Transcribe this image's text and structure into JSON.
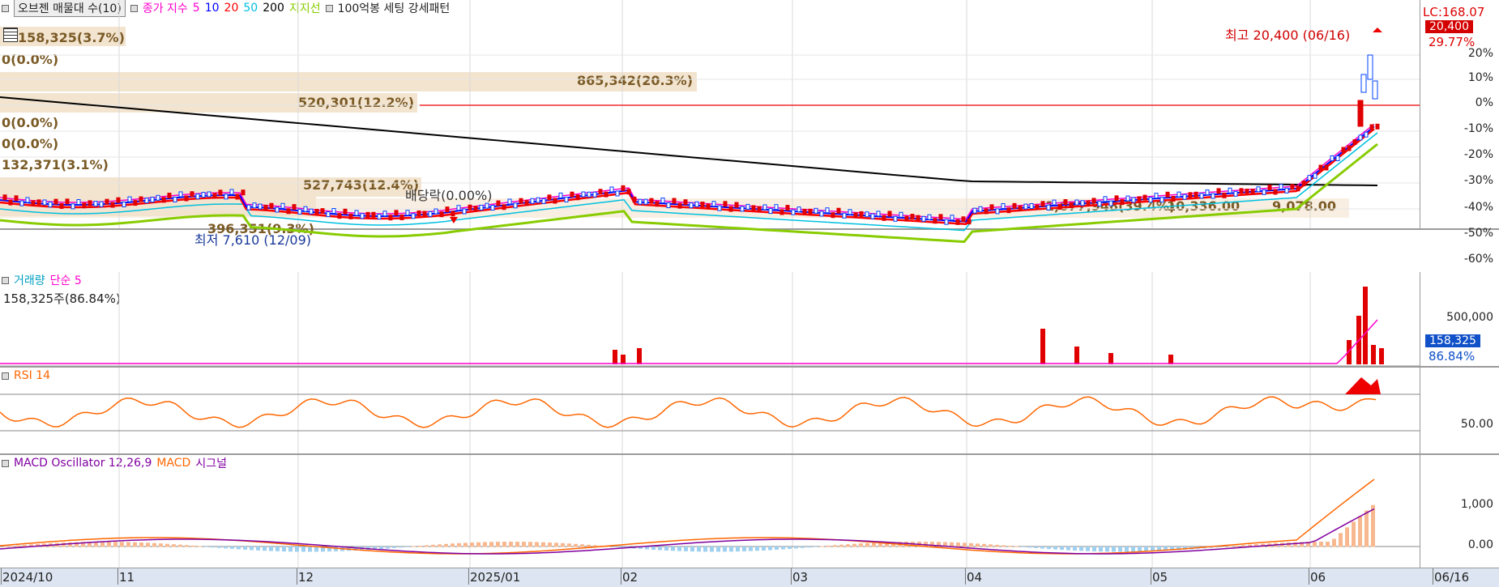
{
  "main_panel": {
    "header": {
      "button": "오브젠 매물대 수(10)",
      "ma_label": "종가 지수",
      "ma_periods": [
        "5",
        "10",
        "20",
        "50",
        "200"
      ],
      "support_label": "지지선",
      "pattern_label": "100억봉 세팅 강세패턴"
    },
    "volume_profile_labels": [
      "158,325(3.7%)",
      "0(0.0%)",
      "865,342(20.3%)",
      "520,301(12.2%)",
      "0(0.0%)",
      "0(0.0%)",
      "132,371(3.1%)",
      "527,743(12.4%)",
      "396,351(9.3%)",
      "1,677,948(39.4%)"
    ],
    "dividend_label": "배당락(0.00%)",
    "low_label": "최저 7,610 (12/09)",
    "high_label": "최고 20,400 (06/16)",
    "overlap_values": [
      "10,336.00",
      "9,078.00"
    ],
    "price_axis": {
      "top_label": "LC:168.07",
      "current_price": "20,400",
      "current_pct": "29.77%",
      "ticks": [
        "20%",
        "10%",
        "0%",
        "-10%",
        "-20%",
        "-30%",
        "-40%",
        "-50%",
        "-60%"
      ]
    }
  },
  "volume_panel": {
    "title": "거래량",
    "ma_label": "단순 5",
    "value_label": "158,325주(86.84%)",
    "ticks": [
      "500,000"
    ],
    "current_value": "158,325",
    "current_pct": "86.84%"
  },
  "rsi_panel": {
    "title": "RSI 14",
    "ticks": [
      "50.00"
    ]
  },
  "macd_panel": {
    "title": "MACD Oscillator 12,26,9",
    "macd_label": "MACD",
    "signal_label": "시그널",
    "ticks": [
      "1,000",
      "0.00"
    ]
  },
  "x_axis": {
    "labels": [
      "2024/10",
      "11",
      "12",
      "2025/01",
      "02",
      "03",
      "04",
      "05",
      "06"
    ],
    "end_label": "06/16"
  },
  "colors": {
    "ma5": "#ff00cc",
    "ma10": "#0000ff",
    "ma20": "#ff0000",
    "ma50": "#00c0e0",
    "ma200": "#000000",
    "support": "#88cc00",
    "up": "#e00000",
    "down": "#0040ff",
    "rsi": "#ff6600",
    "macd": "#ff6600",
    "signal": "#8000a0"
  }
}
